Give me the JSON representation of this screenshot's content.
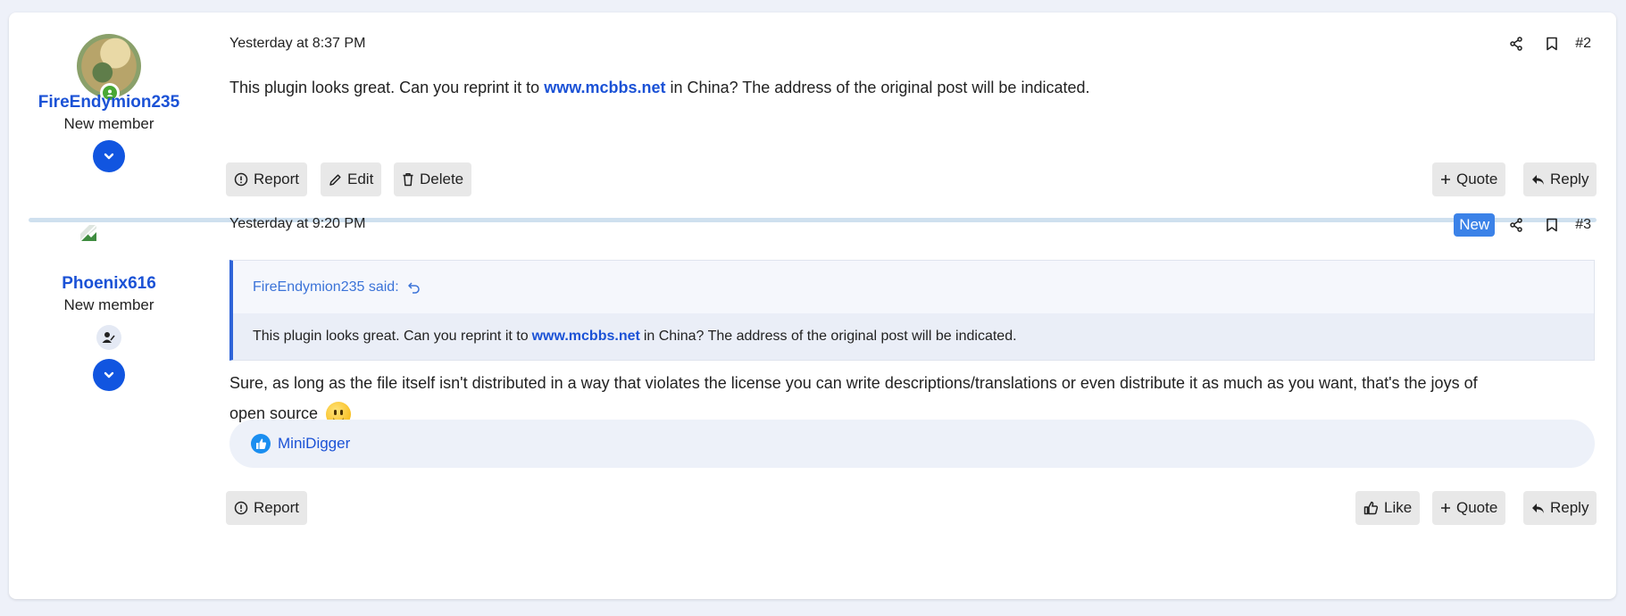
{
  "posts": [
    {
      "username": "FireEndymion235",
      "user_title": "New member",
      "date": "Yesterday at 8:37 PM",
      "post_number": "#2",
      "message_before": "This plugin looks great. Can you reprint it to ",
      "message_link": "www.mcbbs.net",
      "message_after": " in China? The address of the original post will be indicated.",
      "actions_left": [
        "Report",
        "Edit",
        "Delete"
      ],
      "actions_right": [
        "Quote",
        "Reply"
      ]
    },
    {
      "username": "Phoenix616",
      "user_title": "New member",
      "date": "Yesterday at 9:20 PM",
      "badge": "New",
      "post_number": "#3",
      "quote": {
        "author": "FireEndymion235 said:",
        "text_before": "This plugin looks great. Can you reprint it to ",
        "text_link": "www.mcbbs.net",
        "text_after": " in China? The address of the original post will be indicated."
      },
      "message_line1": "Sure, as long as the file itself isn't distributed in a way that violates the license you can write descriptions/translations or even distribute it as much as you want, that's the joys of",
      "message_line2": "open source",
      "reaction_user": "MiniDigger",
      "actions_left": [
        "Report"
      ],
      "actions_right": [
        "Like",
        "Quote",
        "Reply"
      ]
    }
  ],
  "icons": [
    "share-icon",
    "bookmark-icon",
    "report-icon",
    "edit-icon",
    "delete-icon",
    "plus-icon",
    "reply-icon",
    "like-icon",
    "chevron-down-icon",
    "quote-return-icon",
    "smile-emoji-icon"
  ],
  "colors": {
    "accent": "#1155e0",
    "link": "#1b52d6",
    "badge": "#3b82e8",
    "background": "#eef1f9"
  }
}
